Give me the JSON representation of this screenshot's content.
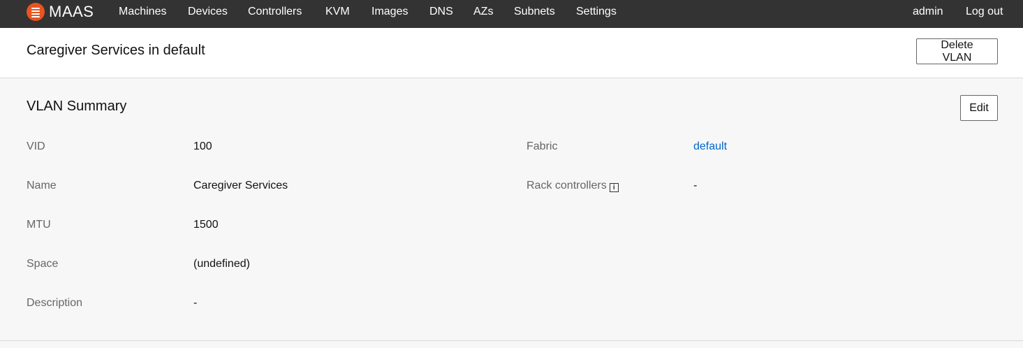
{
  "app": {
    "brand": "MAAS"
  },
  "nav": {
    "items": [
      "Machines",
      "Devices",
      "Controllers",
      "KVM",
      "Images",
      "DNS",
      "AZs",
      "Subnets",
      "Settings"
    ],
    "user": "admin",
    "logout": "Log out"
  },
  "header": {
    "title": "Caregiver Services in default",
    "delete_button": "Delete VLAN"
  },
  "summary": {
    "title": "VLAN Summary",
    "edit_button": "Edit",
    "fields": {
      "vid": {
        "label": "VID",
        "value": "100"
      },
      "name": {
        "label": "Name",
        "value": "Caregiver Services"
      },
      "mtu": {
        "label": "MTU",
        "value": "1500"
      },
      "space": {
        "label": "Space",
        "value": "(undefined)"
      },
      "description": {
        "label": "Description",
        "value": "-"
      },
      "fabric": {
        "label": "Fabric",
        "value": "default"
      },
      "rack_controllers": {
        "label": "Rack controllers",
        "value": "-",
        "info_icon": "i"
      }
    }
  },
  "colors": {
    "navbar": "#333333",
    "brand_accent": "#e95420",
    "link": "#0066cc"
  }
}
